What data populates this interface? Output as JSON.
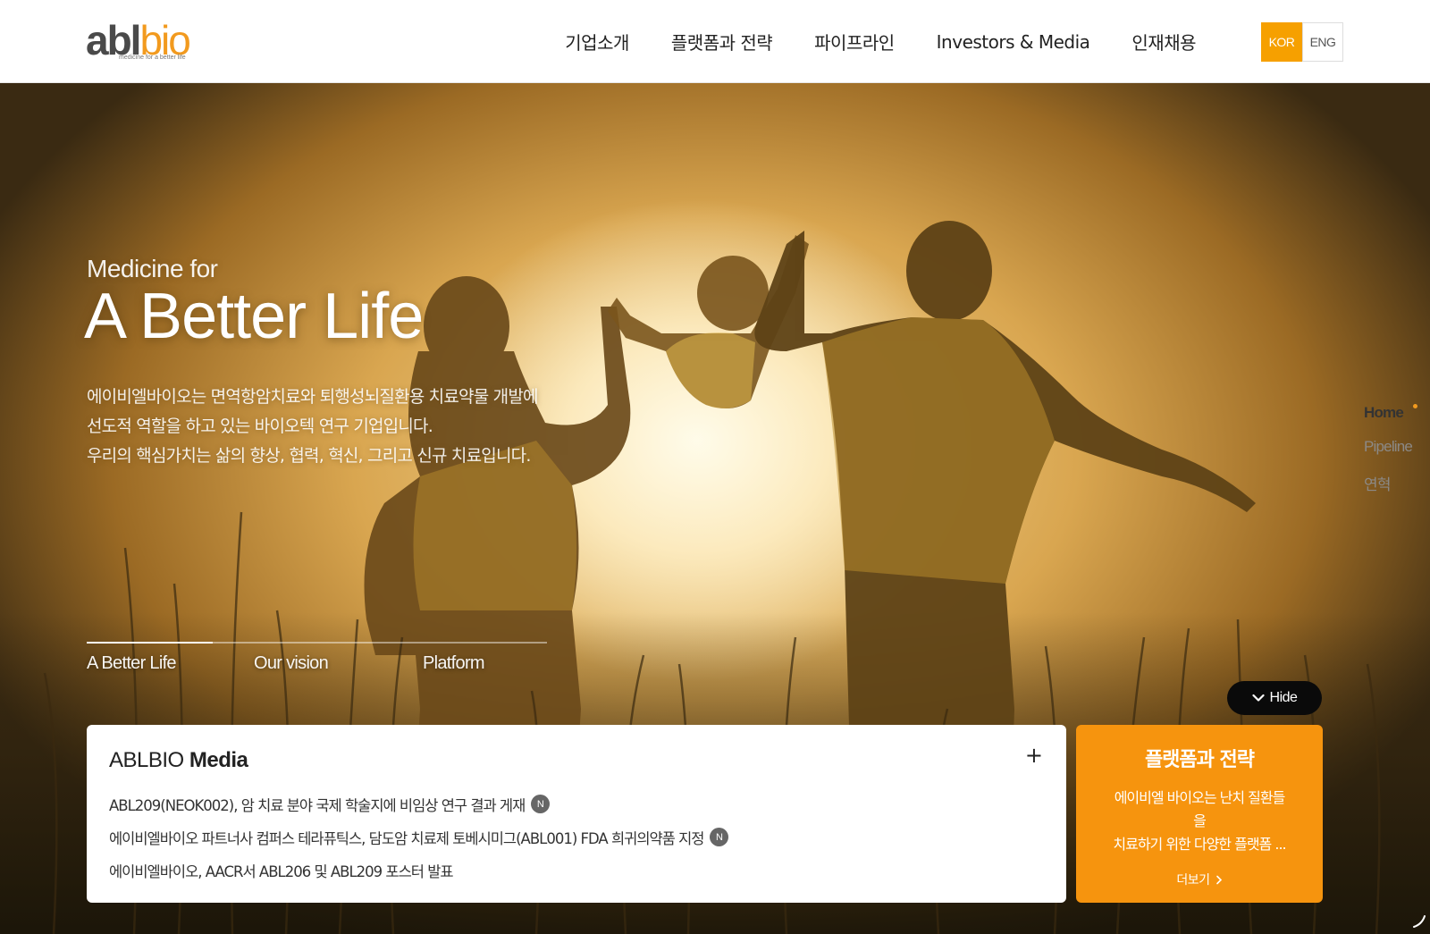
{
  "header": {
    "logo": {
      "main_abl": "abl",
      "main_bio": "bio",
      "tagline": "medicine for a better life"
    },
    "nav": [
      {
        "label": "기업소개"
      },
      {
        "label": "플랫폼과 전략"
      },
      {
        "label": "파이프라인"
      },
      {
        "label": "Investors & Media"
      },
      {
        "label": "인재채용"
      }
    ],
    "lang": {
      "kor": "KOR",
      "eng": "ENG",
      "active": "KOR"
    }
  },
  "hero": {
    "subtitle": "Medicine for",
    "title": "A Better Life",
    "description": [
      "에이비엘바이오는 면역항암치료와 퇴행성뇌질환용 치료약물 개발에",
      "선도적 역할을 하고 있는 바이오텍 연구 기업입니다.",
      "우리의 핵심가치는 삶의 향상, 협력, 혁신, 그리고 신규 치료입니다."
    ]
  },
  "slide_tabs": {
    "items": [
      {
        "label": "A Better Life"
      },
      {
        "label": "Our vision"
      },
      {
        "label": "Platform"
      }
    ],
    "active_index": 0
  },
  "side_nav": {
    "items": [
      {
        "label": "Home"
      },
      {
        "label": "Pipeline"
      },
      {
        "label": "연혁"
      }
    ],
    "active_index": 0
  },
  "hide_button": {
    "label": "Hide"
  },
  "media": {
    "title_light": "ABLBIO",
    "title_bold": "Media",
    "plus": "+",
    "news": [
      {
        "text": "ABL209(NEOK002), 암 치료 분야 국제 학술지에 비임상 연구 결과 게재",
        "badge": "N"
      },
      {
        "text": "에이비엘바이오 파트너사 컴퍼스 테라퓨틱스, 담도암 치료제 토베시미그(ABL001) FDA 희귀의약품 지정",
        "badge": "N"
      },
      {
        "text": "에이비엘바이오, AACR서 ABL206 및 ABL209 포스터 발표",
        "badge": null
      }
    ]
  },
  "platform_card": {
    "title": "플랫폼과 전략",
    "description_lines": [
      "에이비엘 바이오는 난치 질환들",
      "을",
      "치료하기 위한 다양한 플랫폼 ..."
    ],
    "more_label": "더보기"
  },
  "colors": {
    "accent": "#f6940e",
    "lang_active": "#f6a000",
    "logo_bio": "#f29a1e"
  }
}
